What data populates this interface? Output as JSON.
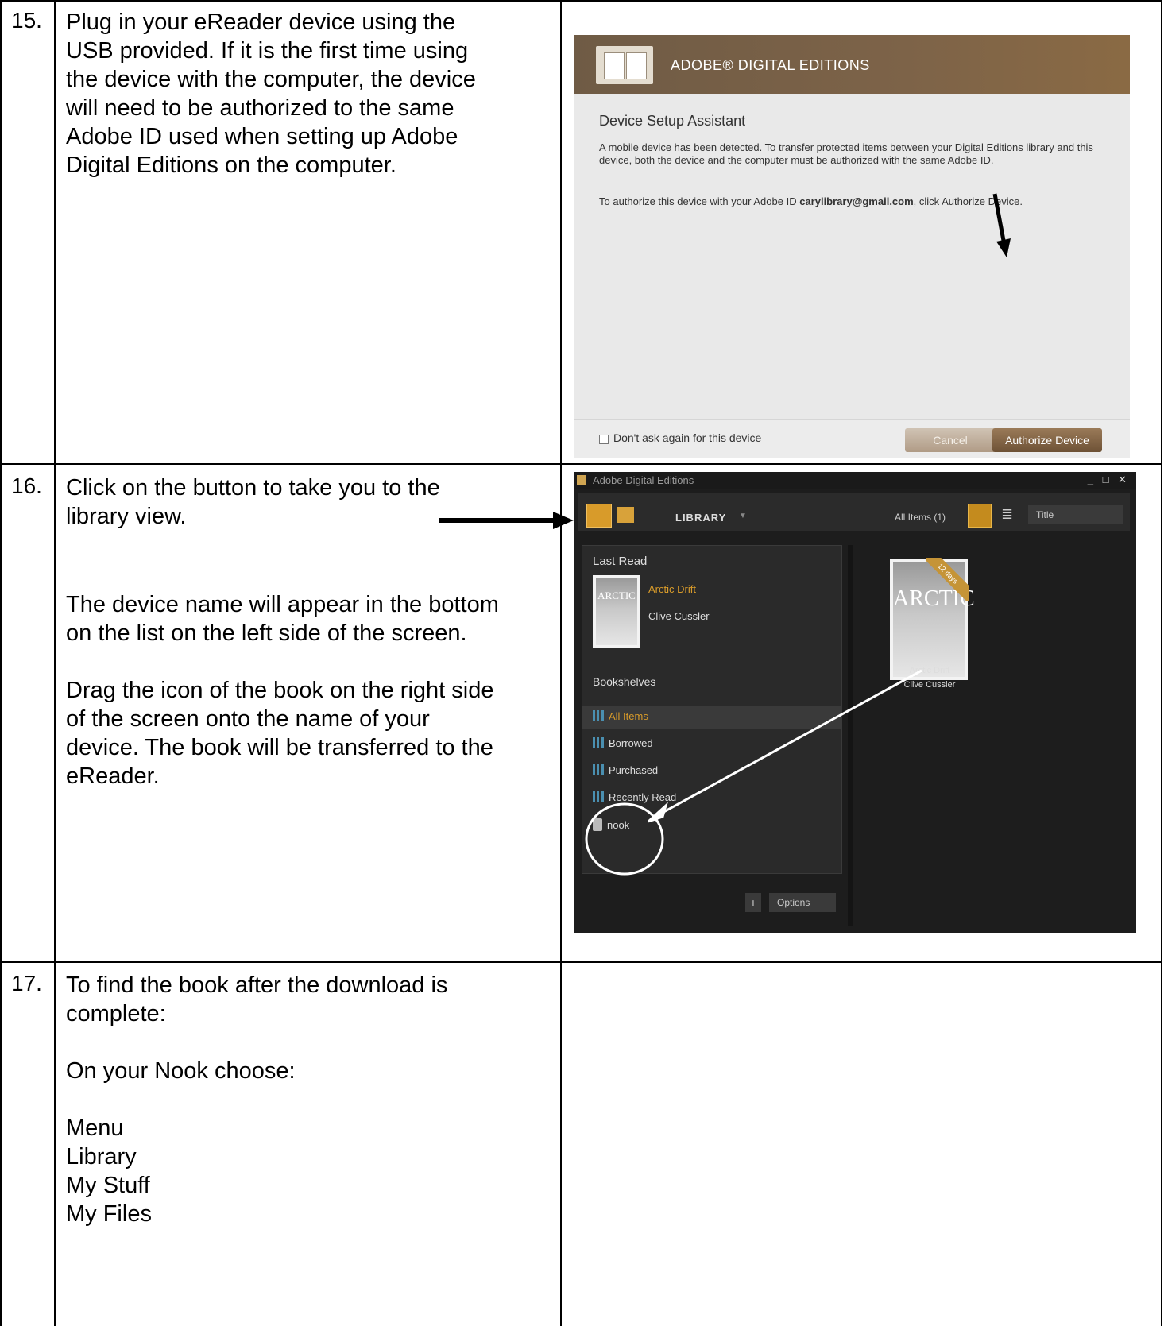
{
  "steps": [
    {
      "number": "15.",
      "text": "Plug in your eReader device using the\nUSB provided.  If it is the first time using\nthe device with the computer, the device\nwill need to be authorized to the same\nAdobe ID used when setting up Adobe\nDigital Editions on the computer."
    },
    {
      "number": "16.",
      "text": "Click on the button to take you to the\nlibrary view.",
      "text2": "The device name will appear in the bottom\non the list on the left side of the screen.\n\nDrag the icon of the book on the right side\nof the screen onto the name of your\ndevice.  The book will be transferred to the\neReader."
    },
    {
      "number": "17.",
      "text": "To find the book after the download is\ncomplete:\n\nOn your Nook choose:\n\nMenu\nLibrary\nMy Stuff\nMy Files"
    }
  ],
  "setup_dialog": {
    "brand": "ADOBE® DIGITAL EDITIONS",
    "heading": "Device Setup Assistant",
    "paragraph1": "A mobile device has been detected. To transfer protected items between your Digital Editions library and this device, both the device and the computer must be authorized with the same Adobe ID.",
    "paragraph2_prefix": "To authorize this device with your Adobe ID ",
    "adobe_id": "carylibrary@gmail.com",
    "paragraph2_suffix": ", click Authorize Device.",
    "checkbox_label": "Don't ask again for this device",
    "cancel_label": "Cancel",
    "authorize_label": "Authorize Device"
  },
  "library_window": {
    "title": "Adobe Digital Editions",
    "window_controls": "_ □ ✕",
    "view_label": "LIBRARY",
    "item_count": "All Items  (1)",
    "sort_label": "Title",
    "last_read_heading": "Last Read",
    "book_title": "Arctic Drift",
    "book_author": "Clive Cussler",
    "cover_text": "ARCTIC",
    "ribbon_text": "12 days",
    "bookshelves_heading": "Bookshelves",
    "shelves": [
      "All Items",
      "Borrowed",
      "Purchased",
      "Recently Read"
    ],
    "device_name": "nook",
    "add_label": "+",
    "options_label": "Options"
  }
}
